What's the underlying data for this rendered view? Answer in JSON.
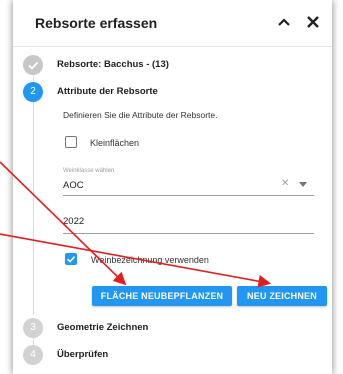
{
  "header": {
    "title": "Rebsorte erfassen"
  },
  "steps": [
    {
      "number": "",
      "label": "Rebsorte: Bacchus - (13)",
      "state": "done"
    },
    {
      "number": "2",
      "label": "Attribute der Rebsorte",
      "state": "active"
    },
    {
      "number": "3",
      "label": "Geometrie Zeichnen",
      "state": "inactive"
    },
    {
      "number": "4",
      "label": "Überprüfen",
      "state": "inactive"
    }
  ],
  "form": {
    "description": "Definieren Sie die Attribute der Rebsorte.",
    "kleinflaechen_label": "Kleinflächen",
    "kleinflaechen_checked": false,
    "weinklasse_caption": "Weinklasse wählen",
    "weinklasse_value": "AOC",
    "year_value": "2022",
    "weinbezeichnung_label": "Weinbezeichnung verwenden",
    "weinbezeichnung_checked": true
  },
  "buttons": {
    "neubepflanzen": "FLÄCHE NEUBEPFLANZEN",
    "neu_zeichnen": "NEU ZEICHNEN"
  },
  "colors": {
    "accent": "#2196f3",
    "arrow": "#e02020"
  },
  "icons": {
    "collapse": "chevron-up-icon",
    "close": "close-icon",
    "done": "check-icon"
  }
}
